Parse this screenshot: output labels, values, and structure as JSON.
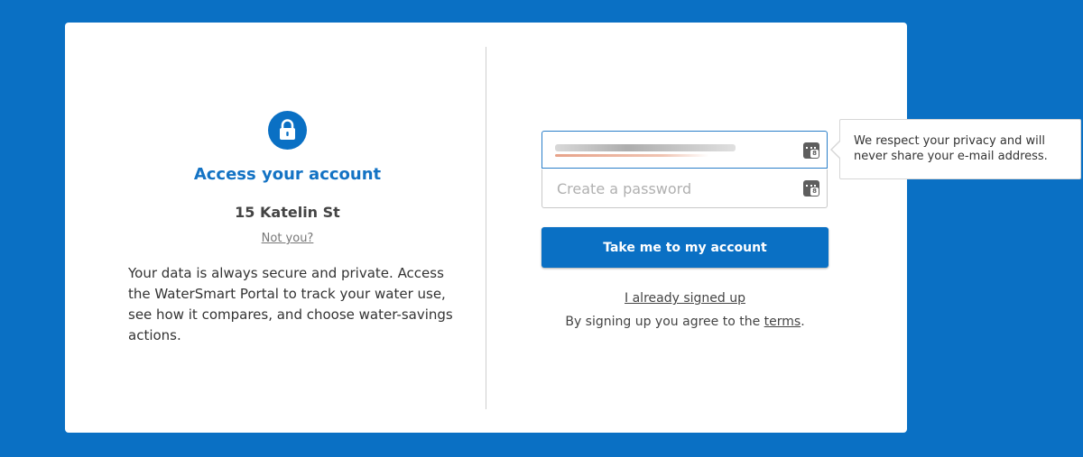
{
  "left": {
    "title": "Access your account",
    "address": "15 Katelin St",
    "not_you": "Not you?",
    "description": "Your data is always secure and private. Access the WaterSmart Portal to track your water use, see how it compares, and choose water-savings actions."
  },
  "form": {
    "email_value": "",
    "password_placeholder": "Create a password",
    "submit_label": "Take me to my account",
    "signed_up_label": "I already signed up",
    "terms_prefix": "By signing up you agree to the ",
    "terms_link": "terms",
    "terms_suffix": "."
  },
  "tooltip": {
    "text": "We respect your privacy and will never share your e-mail address."
  },
  "icons": {
    "lock": "lock-icon",
    "password_manager": "password-manager-icon"
  },
  "colors": {
    "background": "#0a70c4",
    "accent": "#1473c4"
  }
}
